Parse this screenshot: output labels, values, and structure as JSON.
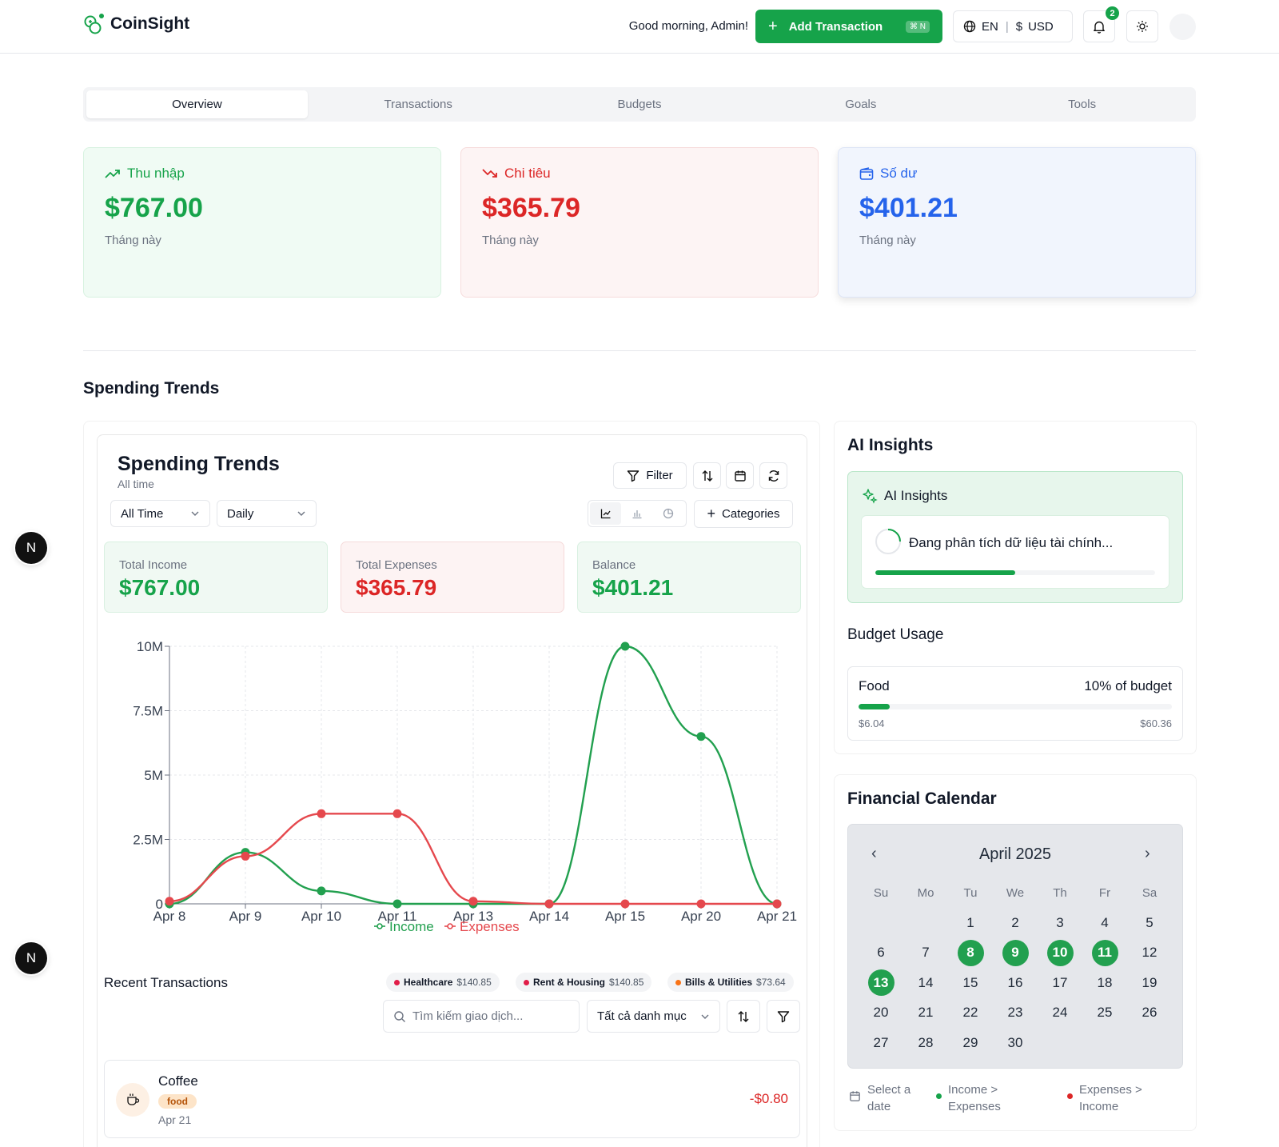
{
  "header": {
    "brand": "CoinSight",
    "greeting": "Good morning, Admin!",
    "add_label": "Add Transaction",
    "add_shortcut": "⌘ N",
    "language": "EN",
    "currency": "USD",
    "notification_count": "2"
  },
  "tabs": [
    "Overview",
    "Transactions",
    "Budgets",
    "Goals",
    "Tools"
  ],
  "summary": {
    "income": {
      "label": "Thu nhập",
      "amount": "$767.00",
      "period": "Tháng này"
    },
    "expense": {
      "label": "Chi tiêu",
      "amount": "$365.79",
      "period": "Tháng này"
    },
    "balance": {
      "label": "Số dư",
      "amount": "$401.21",
      "period": "Tháng này"
    }
  },
  "section_title": "Spending Trends",
  "trends": {
    "title": "Spending Trends",
    "subtitle": "All time",
    "filter_label": "Filter",
    "range_select": "All Time",
    "interval_select": "Daily",
    "categories_label": "Categories",
    "totals": {
      "income_label": "Total Income",
      "income": "$767.00",
      "expenses_label": "Total Expenses",
      "expenses": "$365.79",
      "balance_label": "Balance",
      "balance": "$401.21"
    }
  },
  "chart_data": {
    "type": "line",
    "x": [
      "Apr 8",
      "Apr 9",
      "Apr 10",
      "Apr 11",
      "Apr 13",
      "Apr 14",
      "Apr 15",
      "Apr 20",
      "Apr 21"
    ],
    "yticks": [
      "0",
      "2.5M",
      "5M",
      "7.5M",
      "10M"
    ],
    "ylim": [
      0,
      10000000
    ],
    "grid": true,
    "legend": "bottom-center",
    "series": [
      {
        "name": "Income",
        "color": "#22a04f",
        "values": [
          0,
          2000000,
          500000,
          0,
          0,
          0,
          10000000,
          6500000,
          0
        ]
      },
      {
        "name": "Expenses",
        "color": "#e5484d",
        "values": [
          100000,
          1850000,
          3500000,
          3500000,
          100000,
          0,
          0,
          0,
          0
        ]
      }
    ]
  },
  "recent": {
    "title": "Recent Transactions",
    "top_categories": [
      {
        "name": "Healthcare",
        "amount": "$140.85",
        "color": "#e11d48"
      },
      {
        "name": "Rent & Housing",
        "amount": "$140.85",
        "color": "#e11d48"
      },
      {
        "name": "Bills & Utilities",
        "amount": "$73.64",
        "color": "#f97316"
      }
    ],
    "search_placeholder": "Tìm kiếm giao dịch...",
    "category_select": "Tất cả danh mục",
    "items": [
      {
        "name": "Coffee",
        "category": "food",
        "date": "Apr 21",
        "amount": "-$0.80"
      }
    ]
  },
  "ai": {
    "title": "AI Insights",
    "box_title": "AI Insights",
    "message": "Đang phân tích dữ liệu tài chính...",
    "progress": 0.5
  },
  "budget": {
    "title": "Budget Usage",
    "category": "Food",
    "percent_label": "10% of budget",
    "spent": "$6.04",
    "limit": "$60.36",
    "fraction": 0.1
  },
  "calendar": {
    "title": "Financial Calendar",
    "month": "April 2025",
    "weekdays": [
      "Su",
      "Mo",
      "Tu",
      "We",
      "Th",
      "Fr",
      "Sa"
    ],
    "first_weekday": 2,
    "days_in_month": 30,
    "highlighted_days": [
      8,
      9,
      10,
      11,
      13
    ],
    "legend": [
      "Select a date",
      "Income > Expenses",
      "Expenses > Income"
    ]
  },
  "dev_badge": "N"
}
